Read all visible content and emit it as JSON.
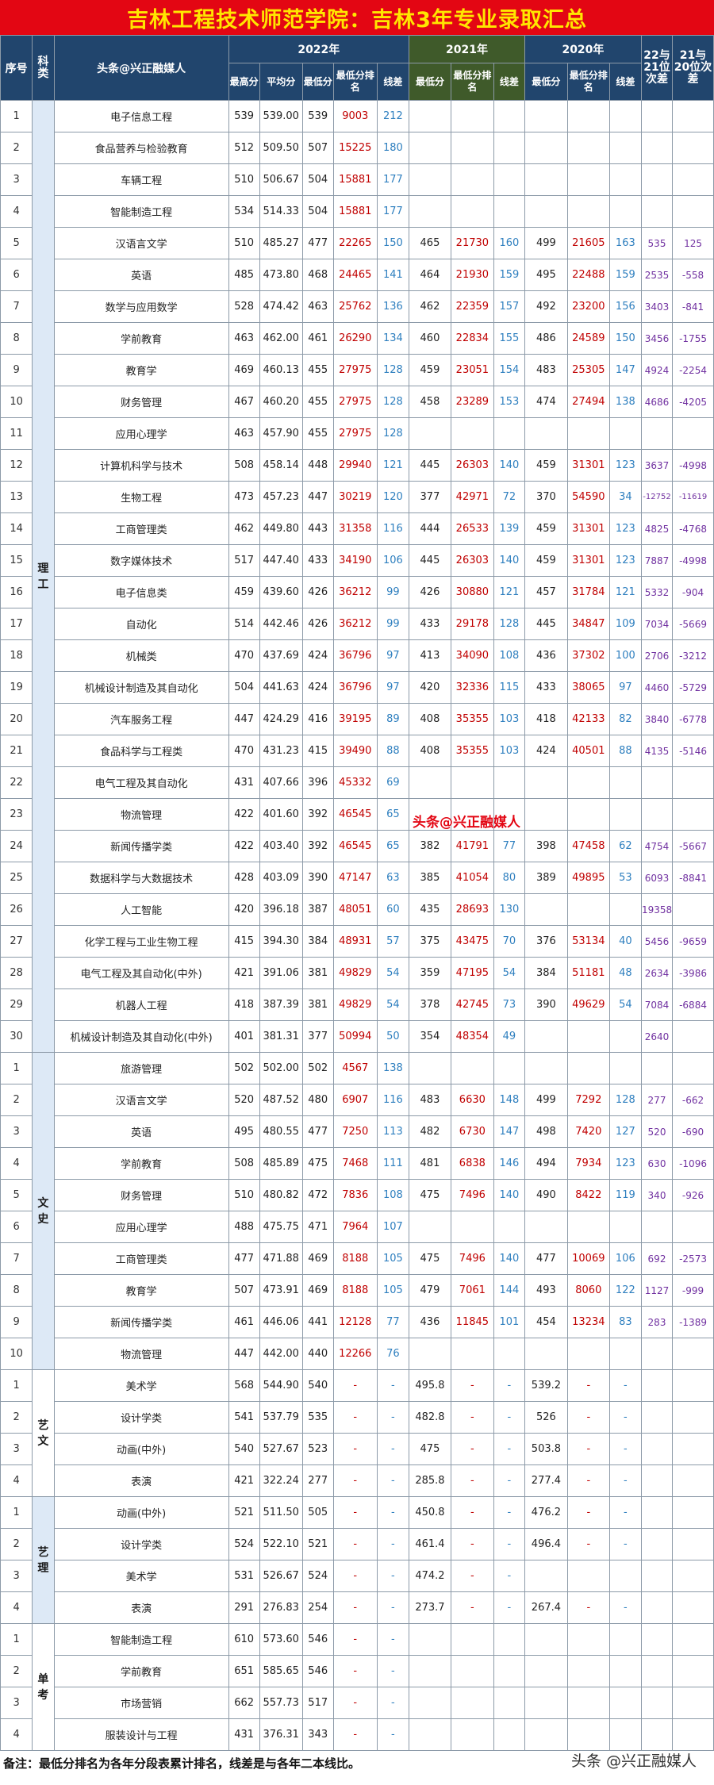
{
  "title": "吉林工程技术师范学院：吉林3年专业录取汇总",
  "header": {
    "seq": "序号",
    "cat": "科类",
    "brand": "头条@兴正融媒人",
    "y2022": "2022年",
    "y2021": "2021年",
    "y2020": "2020年",
    "d1": "22与21位次差",
    "d2": "21与20位次差",
    "max": "最高分",
    "avg": "平均分",
    "min": "最低分",
    "rank": "最低分排名",
    "line": "线差"
  },
  "watermark": "头条@兴正融媒人",
  "note": "备注：最低分排名为各年分段表累计排名，线差是与各年二本线比。",
  "logo": "头条 @兴正融媒人",
  "groups": [
    {
      "cat": "理工",
      "rows": [
        [
          "1",
          "电子信息工程",
          "539",
          "539.00",
          "539",
          "9003",
          "212",
          "",
          "",
          "",
          "",
          "",
          "",
          "",
          ""
        ],
        [
          "2",
          "食品营养与检验教育",
          "512",
          "509.50",
          "507",
          "15225",
          "180",
          "",
          "",
          "",
          "",
          "",
          "",
          "",
          ""
        ],
        [
          "3",
          "车辆工程",
          "510",
          "506.67",
          "504",
          "15881",
          "177",
          "",
          "",
          "",
          "",
          "",
          "",
          "",
          ""
        ],
        [
          "4",
          "智能制造工程",
          "534",
          "514.33",
          "504",
          "15881",
          "177",
          "",
          "",
          "",
          "",
          "",
          "",
          "",
          ""
        ],
        [
          "5",
          "汉语言文学",
          "510",
          "485.27",
          "477",
          "22265",
          "150",
          "465",
          "21730",
          "160",
          "499",
          "21605",
          "163",
          "535",
          "125"
        ],
        [
          "6",
          "英语",
          "485",
          "473.80",
          "468",
          "24465",
          "141",
          "464",
          "21930",
          "159",
          "495",
          "22488",
          "159",
          "2535",
          "-558"
        ],
        [
          "7",
          "数学与应用数学",
          "528",
          "474.42",
          "463",
          "25762",
          "136",
          "462",
          "22359",
          "157",
          "492",
          "23200",
          "156",
          "3403",
          "-841"
        ],
        [
          "8",
          "学前教育",
          "463",
          "462.00",
          "461",
          "26290",
          "134",
          "460",
          "22834",
          "155",
          "486",
          "24589",
          "150",
          "3456",
          "-1755"
        ],
        [
          "9",
          "教育学",
          "469",
          "460.13",
          "455",
          "27975",
          "128",
          "459",
          "23051",
          "154",
          "483",
          "25305",
          "147",
          "4924",
          "-2254"
        ],
        [
          "10",
          "财务管理",
          "467",
          "460.20",
          "455",
          "27975",
          "128",
          "458",
          "23289",
          "153",
          "474",
          "27494",
          "138",
          "4686",
          "-4205"
        ],
        [
          "11",
          "应用心理学",
          "463",
          "457.90",
          "455",
          "27975",
          "128",
          "",
          "",
          "",
          "",
          "",
          "",
          "",
          ""
        ],
        [
          "12",
          "计算机科学与技术",
          "508",
          "458.14",
          "448",
          "29940",
          "121",
          "445",
          "26303",
          "140",
          "459",
          "31301",
          "123",
          "3637",
          "-4998"
        ],
        [
          "13",
          "生物工程",
          "473",
          "457.23",
          "447",
          "30219",
          "120",
          "377",
          "42971",
          "72",
          "370",
          "54590",
          "34",
          "-12752",
          "-11619"
        ],
        [
          "14",
          "工商管理类",
          "462",
          "449.80",
          "443",
          "31358",
          "116",
          "444",
          "26533",
          "139",
          "459",
          "31301",
          "123",
          "4825",
          "-4768"
        ],
        [
          "15",
          "数字媒体技术",
          "517",
          "447.40",
          "433",
          "34190",
          "106",
          "445",
          "26303",
          "140",
          "459",
          "31301",
          "123",
          "7887",
          "-4998"
        ],
        [
          "16",
          "电子信息类",
          "459",
          "439.60",
          "426",
          "36212",
          "99",
          "426",
          "30880",
          "121",
          "457",
          "31784",
          "121",
          "5332",
          "-904"
        ],
        [
          "17",
          "自动化",
          "514",
          "442.46",
          "426",
          "36212",
          "99",
          "433",
          "29178",
          "128",
          "445",
          "34847",
          "109",
          "7034",
          "-5669"
        ],
        [
          "18",
          "机械类",
          "470",
          "437.69",
          "424",
          "36796",
          "97",
          "413",
          "34090",
          "108",
          "436",
          "37302",
          "100",
          "2706",
          "-3212"
        ],
        [
          "19",
          "机械设计制造及其自动化",
          "504",
          "441.63",
          "424",
          "36796",
          "97",
          "420",
          "32336",
          "115",
          "433",
          "38065",
          "97",
          "4460",
          "-5729"
        ],
        [
          "20",
          "汽车服务工程",
          "447",
          "424.29",
          "416",
          "39195",
          "89",
          "408",
          "35355",
          "103",
          "418",
          "42133",
          "82",
          "3840",
          "-6778"
        ],
        [
          "21",
          "食品科学与工程类",
          "470",
          "431.23",
          "415",
          "39490",
          "88",
          "408",
          "35355",
          "103",
          "424",
          "40501",
          "88",
          "4135",
          "-5146"
        ],
        [
          "22",
          "电气工程及其自动化",
          "431",
          "407.66",
          "396",
          "45332",
          "69",
          "",
          "",
          "",
          "",
          "",
          "",
          "",
          ""
        ],
        [
          "23",
          "物流管理",
          "422",
          "401.60",
          "392",
          "46545",
          "65",
          "",
          "",
          "",
          "",
          "",
          "",
          "",
          ""
        ],
        [
          "24",
          "新闻传播学类",
          "422",
          "403.40",
          "392",
          "46545",
          "65",
          "382",
          "41791",
          "77",
          "398",
          "47458",
          "62",
          "4754",
          "-5667"
        ],
        [
          "25",
          "数据科学与大数据技术",
          "428",
          "403.09",
          "390",
          "47147",
          "63",
          "385",
          "41054",
          "80",
          "389",
          "49895",
          "53",
          "6093",
          "-8841"
        ],
        [
          "26",
          "人工智能",
          "420",
          "396.18",
          "387",
          "48051",
          "60",
          "435",
          "28693",
          "130",
          "",
          "",
          "",
          "19358",
          ""
        ],
        [
          "27",
          "化学工程与工业生物工程",
          "415",
          "394.30",
          "384",
          "48931",
          "57",
          "375",
          "43475",
          "70",
          "376",
          "53134",
          "40",
          "5456",
          "-9659"
        ],
        [
          "28",
          "电气工程及其自动化(中外)",
          "421",
          "391.06",
          "381",
          "49829",
          "54",
          "359",
          "47195",
          "54",
          "384",
          "51181",
          "48",
          "2634",
          "-3986"
        ],
        [
          "29",
          "机器人工程",
          "418",
          "387.39",
          "381",
          "49829",
          "54",
          "378",
          "42745",
          "73",
          "390",
          "49629",
          "54",
          "7084",
          "-6884"
        ],
        [
          "30",
          "机械设计制造及其自动化(中外)",
          "401",
          "381.31",
          "377",
          "50994",
          "50",
          "354",
          "48354",
          "49",
          "",
          "",
          "",
          "2640",
          ""
        ]
      ]
    },
    {
      "cat": "文史",
      "rows": [
        [
          "1",
          "旅游管理",
          "502",
          "502.00",
          "502",
          "4567",
          "138",
          "",
          "",
          "",
          "",
          "",
          "",
          "",
          ""
        ],
        [
          "2",
          "汉语言文学",
          "520",
          "487.52",
          "480",
          "6907",
          "116",
          "483",
          "6630",
          "148",
          "499",
          "7292",
          "128",
          "277",
          "-662"
        ],
        [
          "3",
          "英语",
          "495",
          "480.55",
          "477",
          "7250",
          "113",
          "482",
          "6730",
          "147",
          "498",
          "7420",
          "127",
          "520",
          "-690"
        ],
        [
          "4",
          "学前教育",
          "508",
          "485.89",
          "475",
          "7468",
          "111",
          "481",
          "6838",
          "146",
          "494",
          "7934",
          "123",
          "630",
          "-1096"
        ],
        [
          "5",
          "财务管理",
          "510",
          "480.82",
          "472",
          "7836",
          "108",
          "475",
          "7496",
          "140",
          "490",
          "8422",
          "119",
          "340",
          "-926"
        ],
        [
          "6",
          "应用心理学",
          "488",
          "475.75",
          "471",
          "7964",
          "107",
          "",
          "",
          "",
          "",
          "",
          "",
          "",
          ""
        ],
        [
          "7",
          "工商管理类",
          "477",
          "471.88",
          "469",
          "8188",
          "105",
          "475",
          "7496",
          "140",
          "477",
          "10069",
          "106",
          "692",
          "-2573"
        ],
        [
          "8",
          "教育学",
          "507",
          "473.91",
          "469",
          "8188",
          "105",
          "479",
          "7061",
          "144",
          "493",
          "8060",
          "122",
          "1127",
          "-999"
        ],
        [
          "9",
          "新闻传播学类",
          "461",
          "446.06",
          "441",
          "12128",
          "77",
          "436",
          "11845",
          "101",
          "454",
          "13234",
          "83",
          "283",
          "-1389"
        ],
        [
          "10",
          "物流管理",
          "447",
          "442.00",
          "440",
          "12266",
          "76",
          "",
          "",
          "",
          "",
          "",
          "",
          "",
          ""
        ]
      ]
    },
    {
      "cat": "艺文",
      "rows": [
        [
          "1",
          "美术学",
          "568",
          "544.90",
          "540",
          "-",
          "-",
          "495.8",
          "-",
          "-",
          "539.2",
          "-",
          "-",
          "",
          ""
        ],
        [
          "2",
          "设计学类",
          "541",
          "537.79",
          "535",
          "-",
          "-",
          "482.8",
          "-",
          "-",
          "526",
          "-",
          "-",
          "",
          ""
        ],
        [
          "3",
          "动画(中外)",
          "540",
          "527.67",
          "523",
          "-",
          "-",
          "475",
          "-",
          "-",
          "503.8",
          "-",
          "-",
          "",
          ""
        ],
        [
          "4",
          "表演",
          "421",
          "322.24",
          "277",
          "-",
          "-",
          "285.8",
          "-",
          "-",
          "277.4",
          "-",
          "-",
          "",
          ""
        ]
      ]
    },
    {
      "cat": "艺理",
      "rows": [
        [
          "1",
          "动画(中外)",
          "521",
          "511.50",
          "505",
          "-",
          "-",
          "450.8",
          "-",
          "-",
          "476.2",
          "-",
          "-",
          "",
          ""
        ],
        [
          "2",
          "设计学类",
          "524",
          "522.10",
          "521",
          "-",
          "-",
          "461.4",
          "-",
          "-",
          "496.4",
          "-",
          "-",
          "",
          ""
        ],
        [
          "3",
          "美术学",
          "531",
          "526.67",
          "524",
          "-",
          "-",
          "474.2",
          "-",
          "-",
          "",
          "",
          "",
          "",
          ""
        ],
        [
          "4",
          "表演",
          "291",
          "276.83",
          "254",
          "-",
          "-",
          "273.7",
          "-",
          "-",
          "267.4",
          "-",
          "-",
          "",
          ""
        ]
      ]
    },
    {
      "cat": "单考",
      "rows": [
        [
          "1",
          "智能制造工程",
          "610",
          "573.60",
          "546",
          "-",
          "-",
          "",
          "",
          "",
          "",
          "",
          "",
          "",
          ""
        ],
        [
          "2",
          "学前教育",
          "651",
          "585.65",
          "546",
          "-",
          "-",
          "",
          "",
          "",
          "",
          "",
          "",
          "",
          ""
        ],
        [
          "3",
          "市场营销",
          "662",
          "557.73",
          "517",
          "-",
          "-",
          "",
          "",
          "",
          "",
          "",
          "",
          "",
          ""
        ],
        [
          "4",
          "服装设计与工程",
          "431",
          "376.31",
          "343",
          "-",
          "-",
          "",
          "",
          "",
          "",
          "",
          "",
          "",
          ""
        ]
      ]
    }
  ]
}
